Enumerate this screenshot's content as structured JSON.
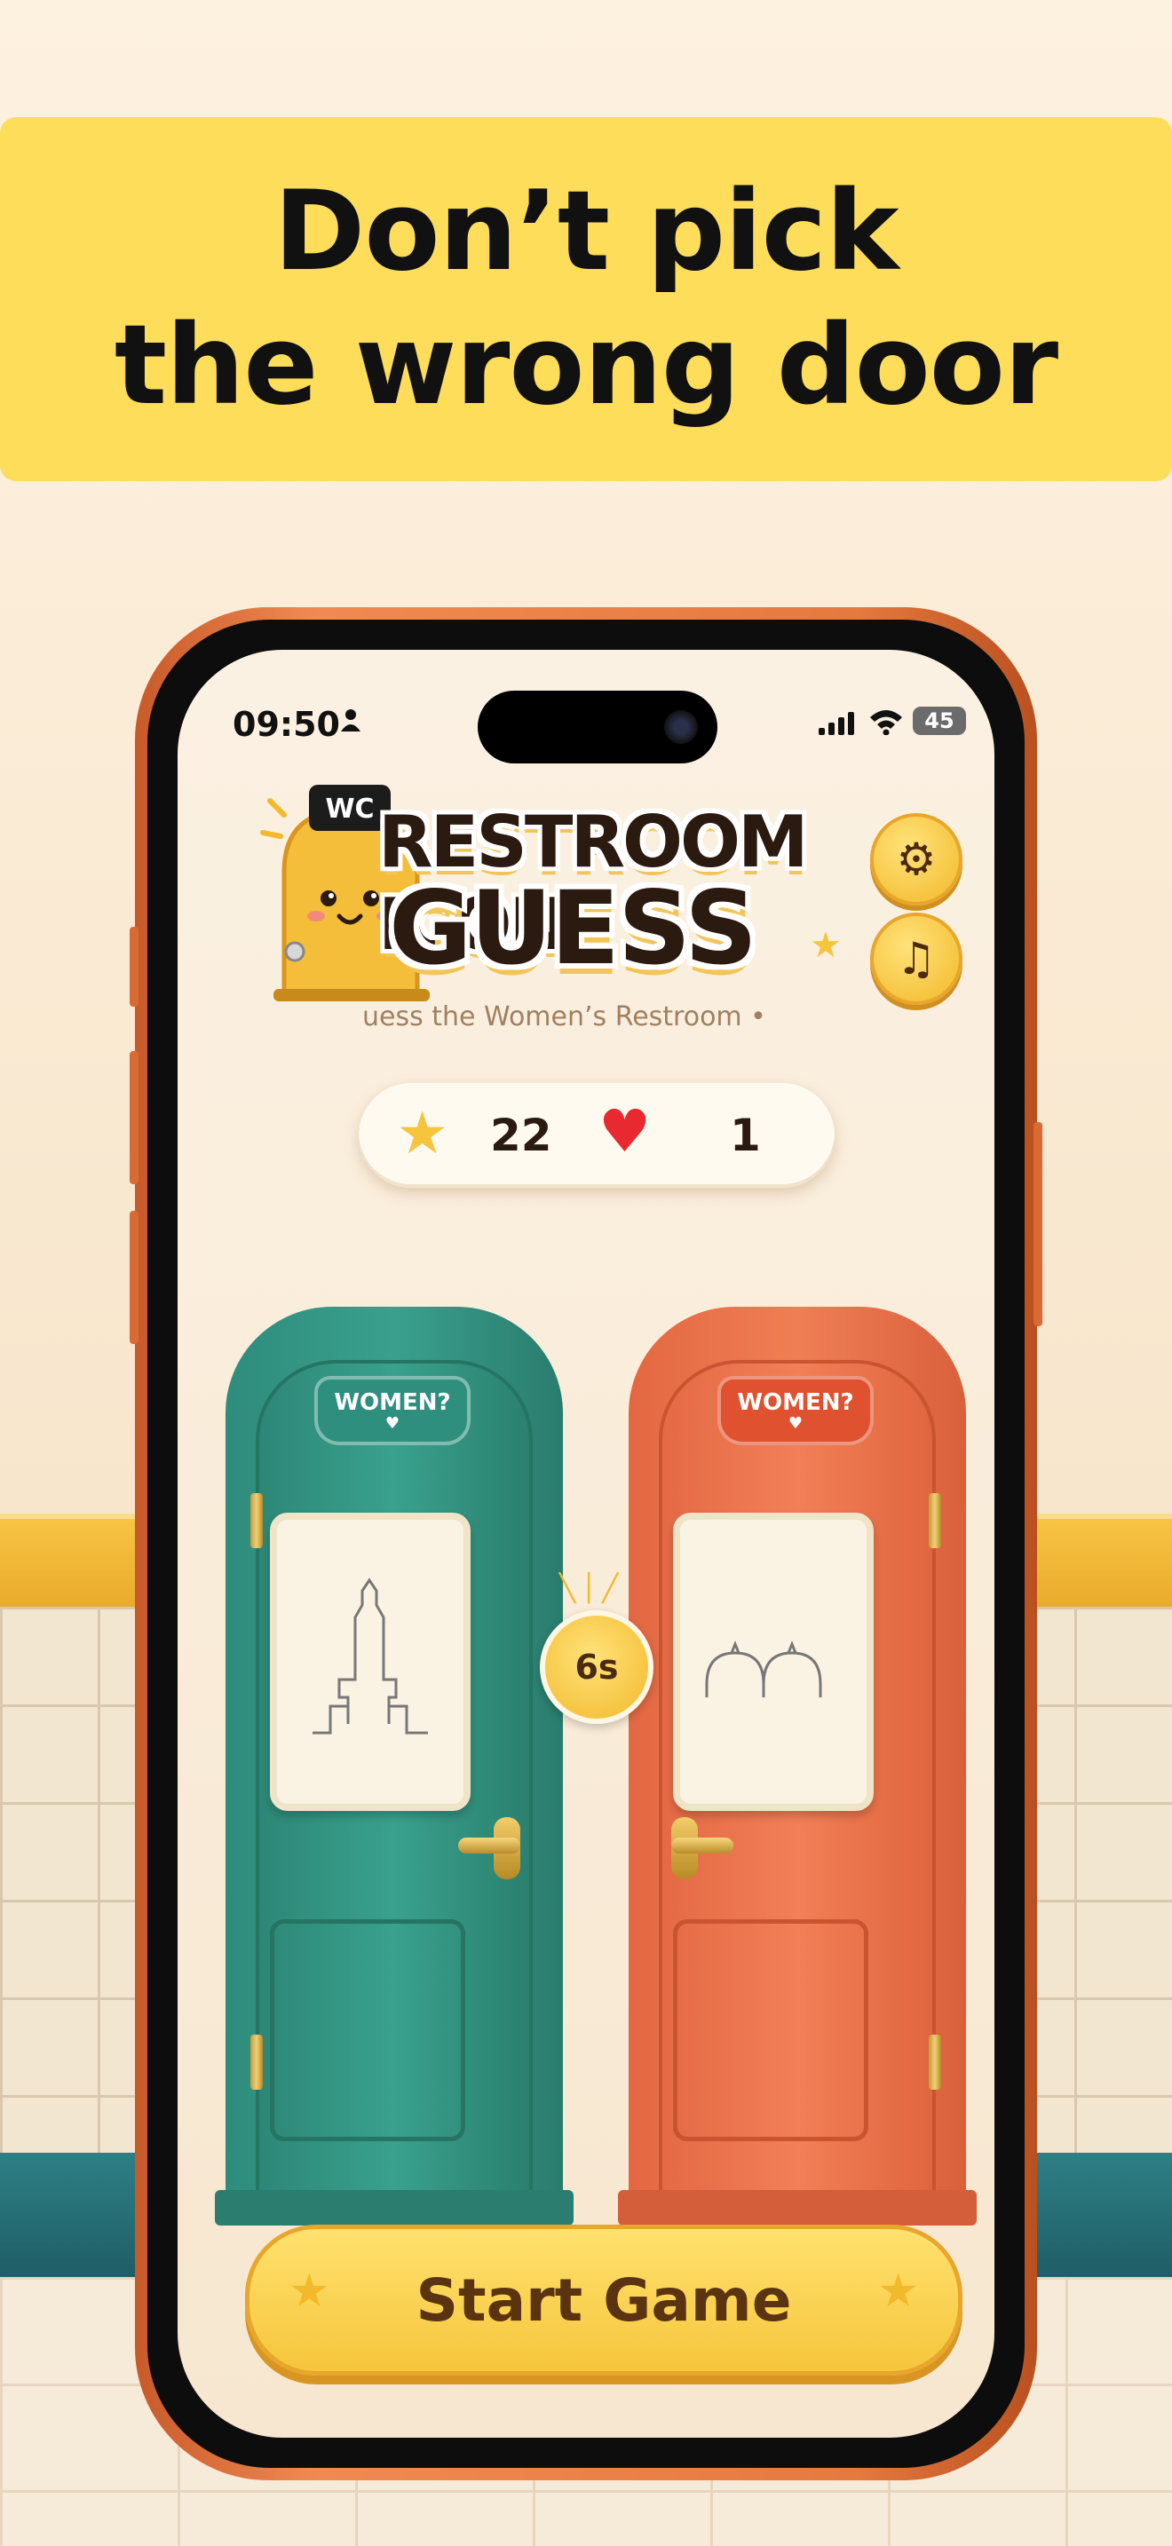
{
  "headline": {
    "line1": "Don’t pick",
    "line2": "the wrong door"
  },
  "status_bar": {
    "time": "09:50",
    "battery": "45"
  },
  "app": {
    "mascot_sign": "WC",
    "title_line1": "RESTROOM ICON",
    "title_line2": "GUESS",
    "subtitle": "uess the Women’s Restroom •"
  },
  "stats": {
    "stars": "22",
    "lives": "1"
  },
  "doors": {
    "left": {
      "sign": "WOMEN?",
      "heart": "♥"
    },
    "right": {
      "sign": "WOMEN?",
      "heart": "♥"
    }
  },
  "timer": "6s",
  "start_button": {
    "label": "Start Game"
  },
  "icons": {
    "settings": "gear-icon",
    "music": "music-note-icon",
    "star": "star-icon",
    "heart": "heart-icon"
  },
  "colors": {
    "headline_bg": "#fedd5a",
    "door_left": "#3aa08d",
    "door_right": "#ef7e55",
    "button_yellow": "#f6c63c"
  }
}
